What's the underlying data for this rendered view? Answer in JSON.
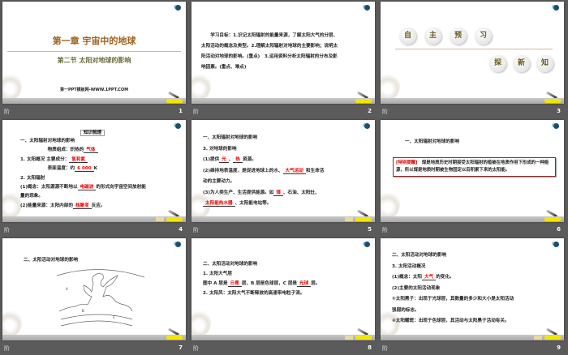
{
  "footer_icon": "阶",
  "slides": [
    {
      "num": "1",
      "title": "第一章  宇宙中的地球",
      "subtitle": "第二节  太阳对地球的影响",
      "site": "第一PPT模板网-WWW.1PPT.COM"
    },
    {
      "num": "2",
      "lines": [
        [
          {
            "t": "　　学习目标：1.识记太阳辐射的能量来源，了解太阳大气的分层、"
          }
        ],
        [
          {
            "t": "太阳活动的概念及类型。2.理解太阳辐射对地球的主要影响；说明太"
          }
        ],
        [
          {
            "t": "阳活动对地球的影响。(重点)　3.运用资料分析太阳辐射的分布及影"
          }
        ],
        [
          {
            "t": "响因素。(重点、难点)"
          }
        ]
      ]
    },
    {
      "num": "3",
      "circles_top": [
        "自",
        "主",
        "预",
        "习"
      ],
      "circles_bottom": [
        "探",
        "新",
        "知"
      ]
    },
    {
      "num": "4",
      "tag": "知识梳理",
      "lines": [
        [
          {
            "t": "一、太阳辐射对地球的影响"
          }
        ],
        [
          {
            "t": "　　　　　　物质组成：炽热的"
          },
          {
            "t": "气体",
            "r": 1
          }
        ],
        [
          {
            "t": "1. 太阳概况 主要成分："
          },
          {
            "t": "氢和氦",
            "r": 1
          }
        ],
        [
          {
            "t": "　　　　　　表面温度：约"
          },
          {
            "t": "6 000",
            "r": 1
          },
          {
            "t": "K"
          }
        ],
        [
          {
            "t": "2. 太阳辐射"
          }
        ],
        [
          {
            "t": "(1)概念：太阳源源不断地以"
          },
          {
            "t": "电磁波",
            "r": 1
          },
          {
            "t": "的形式向宇宙空间放射能"
          }
        ],
        [
          {
            "t": "量的现象。"
          }
        ],
        [
          {
            "t": "(2)能量来源：太阳内部的"
          },
          {
            "t": "核聚变",
            "r": 1
          },
          {
            "t": "反应。"
          }
        ]
      ]
    },
    {
      "num": "5",
      "lines": [
        [
          {
            "t": "一、太阳辐射对地球的影响"
          }
        ],
        [
          {
            "t": "3. 对地球的影响"
          }
        ],
        [
          {
            "t": "(1)提供"
          },
          {
            "t": "光",
            "r": 1
          },
          {
            "t": "、"
          },
          {
            "t": "热",
            "r": 1
          },
          {
            "t": "资源。"
          }
        ],
        [
          {
            "t": "(2)维持地表温度，是促进地球上的水、"
          },
          {
            "t": "大气运动",
            "r": 1
          },
          {
            "t": "和生命活"
          }
        ],
        [
          {
            "t": "动的主要动力。"
          }
        ],
        [
          {
            "t": "(3)为人类生产、生活提供能源。如"
          },
          {
            "t": "煤",
            "r": 1
          },
          {
            "t": "、石油、太阳灶、"
          }
        ],
        [
          {
            "t": "太阳能热水器",
            "r": 1
          },
          {
            "t": "、太阳能电站等。"
          }
        ]
      ]
    },
    {
      "num": "6",
      "heading": "一、太阳辐射对地球的影响",
      "note_label": "[特别提醒]",
      "note": "　煤是地质历史时期接受太阳辐射的植被在地质作用下形成的一种能源，所以煤是地质时期被生物固定以后积累下来的太阳能。"
    },
    {
      "num": "7",
      "heading": "二、太阳活动对地球的影响",
      "labels": [
        "A",
        "B",
        "C"
      ]
    },
    {
      "num": "8",
      "lines": [
        [
          {
            "t": "二、太阳活动对地球的影响"
          }
        ],
        [
          {
            "t": " "
          }
        ],
        [
          {
            "t": "1. 太阳大气层"
          }
        ],
        [
          {
            "t": "图中 A 层是"
          },
          {
            "t": "日冕",
            "r": 1
          },
          {
            "t": "层，B 层是色球层，C 层是"
          },
          {
            "t": "光球",
            "r": 1
          },
          {
            "t": "层。"
          }
        ],
        [
          {
            "t": "2. 太阳风：太阳大气不断释放的高速带电粒子流。"
          }
        ]
      ]
    },
    {
      "num": "9",
      "lines": [
        [
          {
            "t": "二、太阳活动对地球的影响"
          }
        ],
        [
          {
            "t": "3. 太阳活动概况"
          }
        ],
        [
          {
            "t": "(1)概念：太阳"
          },
          {
            "t": "大气",
            "r": 1
          },
          {
            "t": "的变化。"
          }
        ],
        [
          {
            "t": "(2)主要的太阳活动现象"
          }
        ],
        [
          {
            "t": "①太阳黑子：出现于光球层，其数量的多少和大小是太阳活动"
          }
        ],
        [
          {
            "t": "强弱的标志。"
          }
        ],
        [
          {
            "t": "②太阳耀斑：出现于色球层，其活动与太阳黑子活动有关。"
          }
        ]
      ]
    }
  ],
  "colors": {
    "background": "#5b5b5b",
    "answer": "#e00000",
    "title": "#a0601e"
  }
}
